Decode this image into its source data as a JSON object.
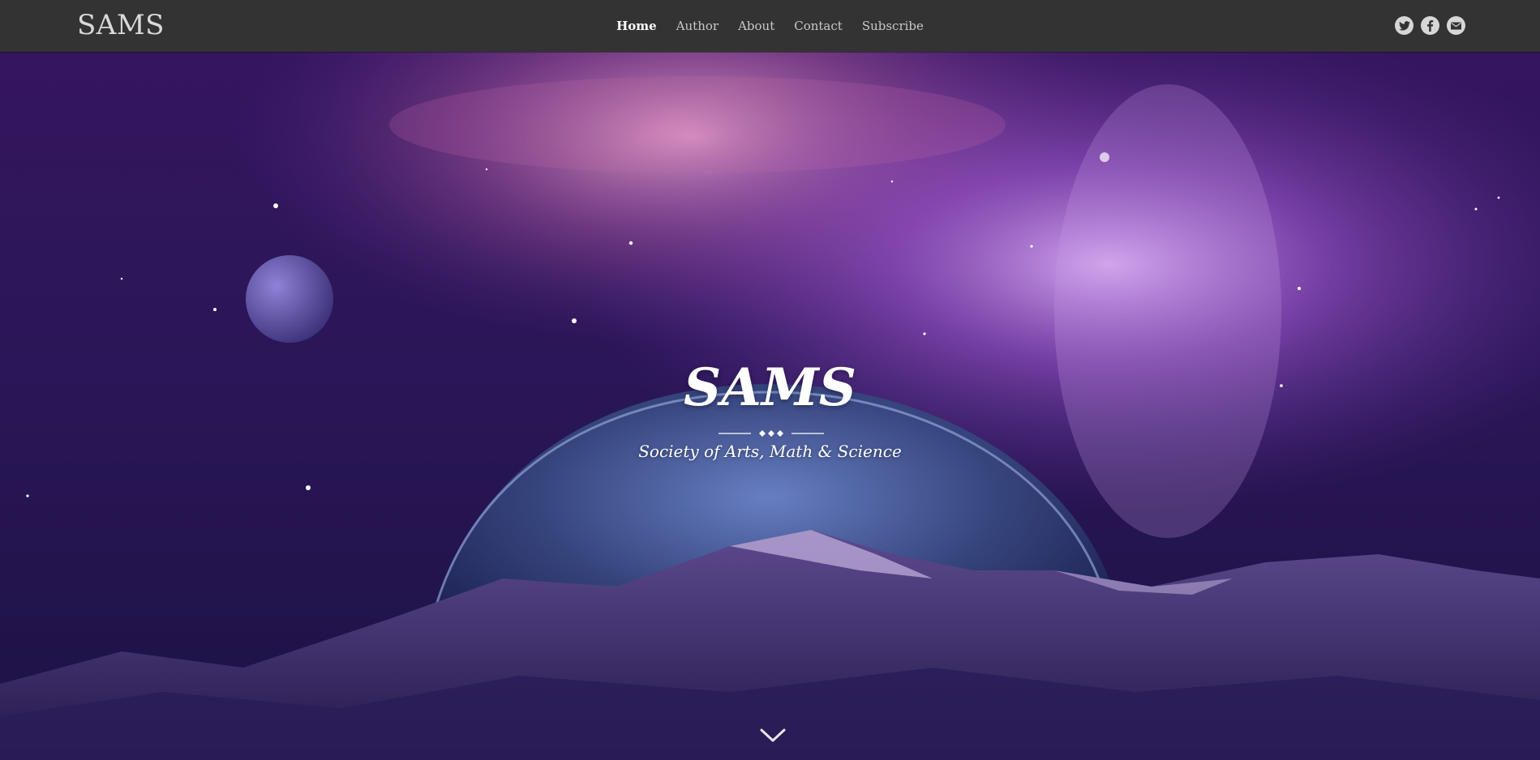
{
  "header": {
    "brand": "SAMS",
    "nav": [
      {
        "label": "Home",
        "active": true
      },
      {
        "label": "Author",
        "active": false
      },
      {
        "label": "About",
        "active": false
      },
      {
        "label": "Contact",
        "active": false
      },
      {
        "label": "Subscribe",
        "active": false
      }
    ],
    "social_icons": [
      "twitter-icon",
      "facebook-icon",
      "email-icon"
    ]
  },
  "hero": {
    "title": "SAMS",
    "subtitle": "Society of Arts, Math & Science",
    "scroll_icon": "chevron-down-icon"
  },
  "colors": {
    "topbar": "#333333",
    "nav_active": "#ffffff",
    "nav_inactive": "#c9c9c9",
    "hero_text": "#ffffff"
  }
}
